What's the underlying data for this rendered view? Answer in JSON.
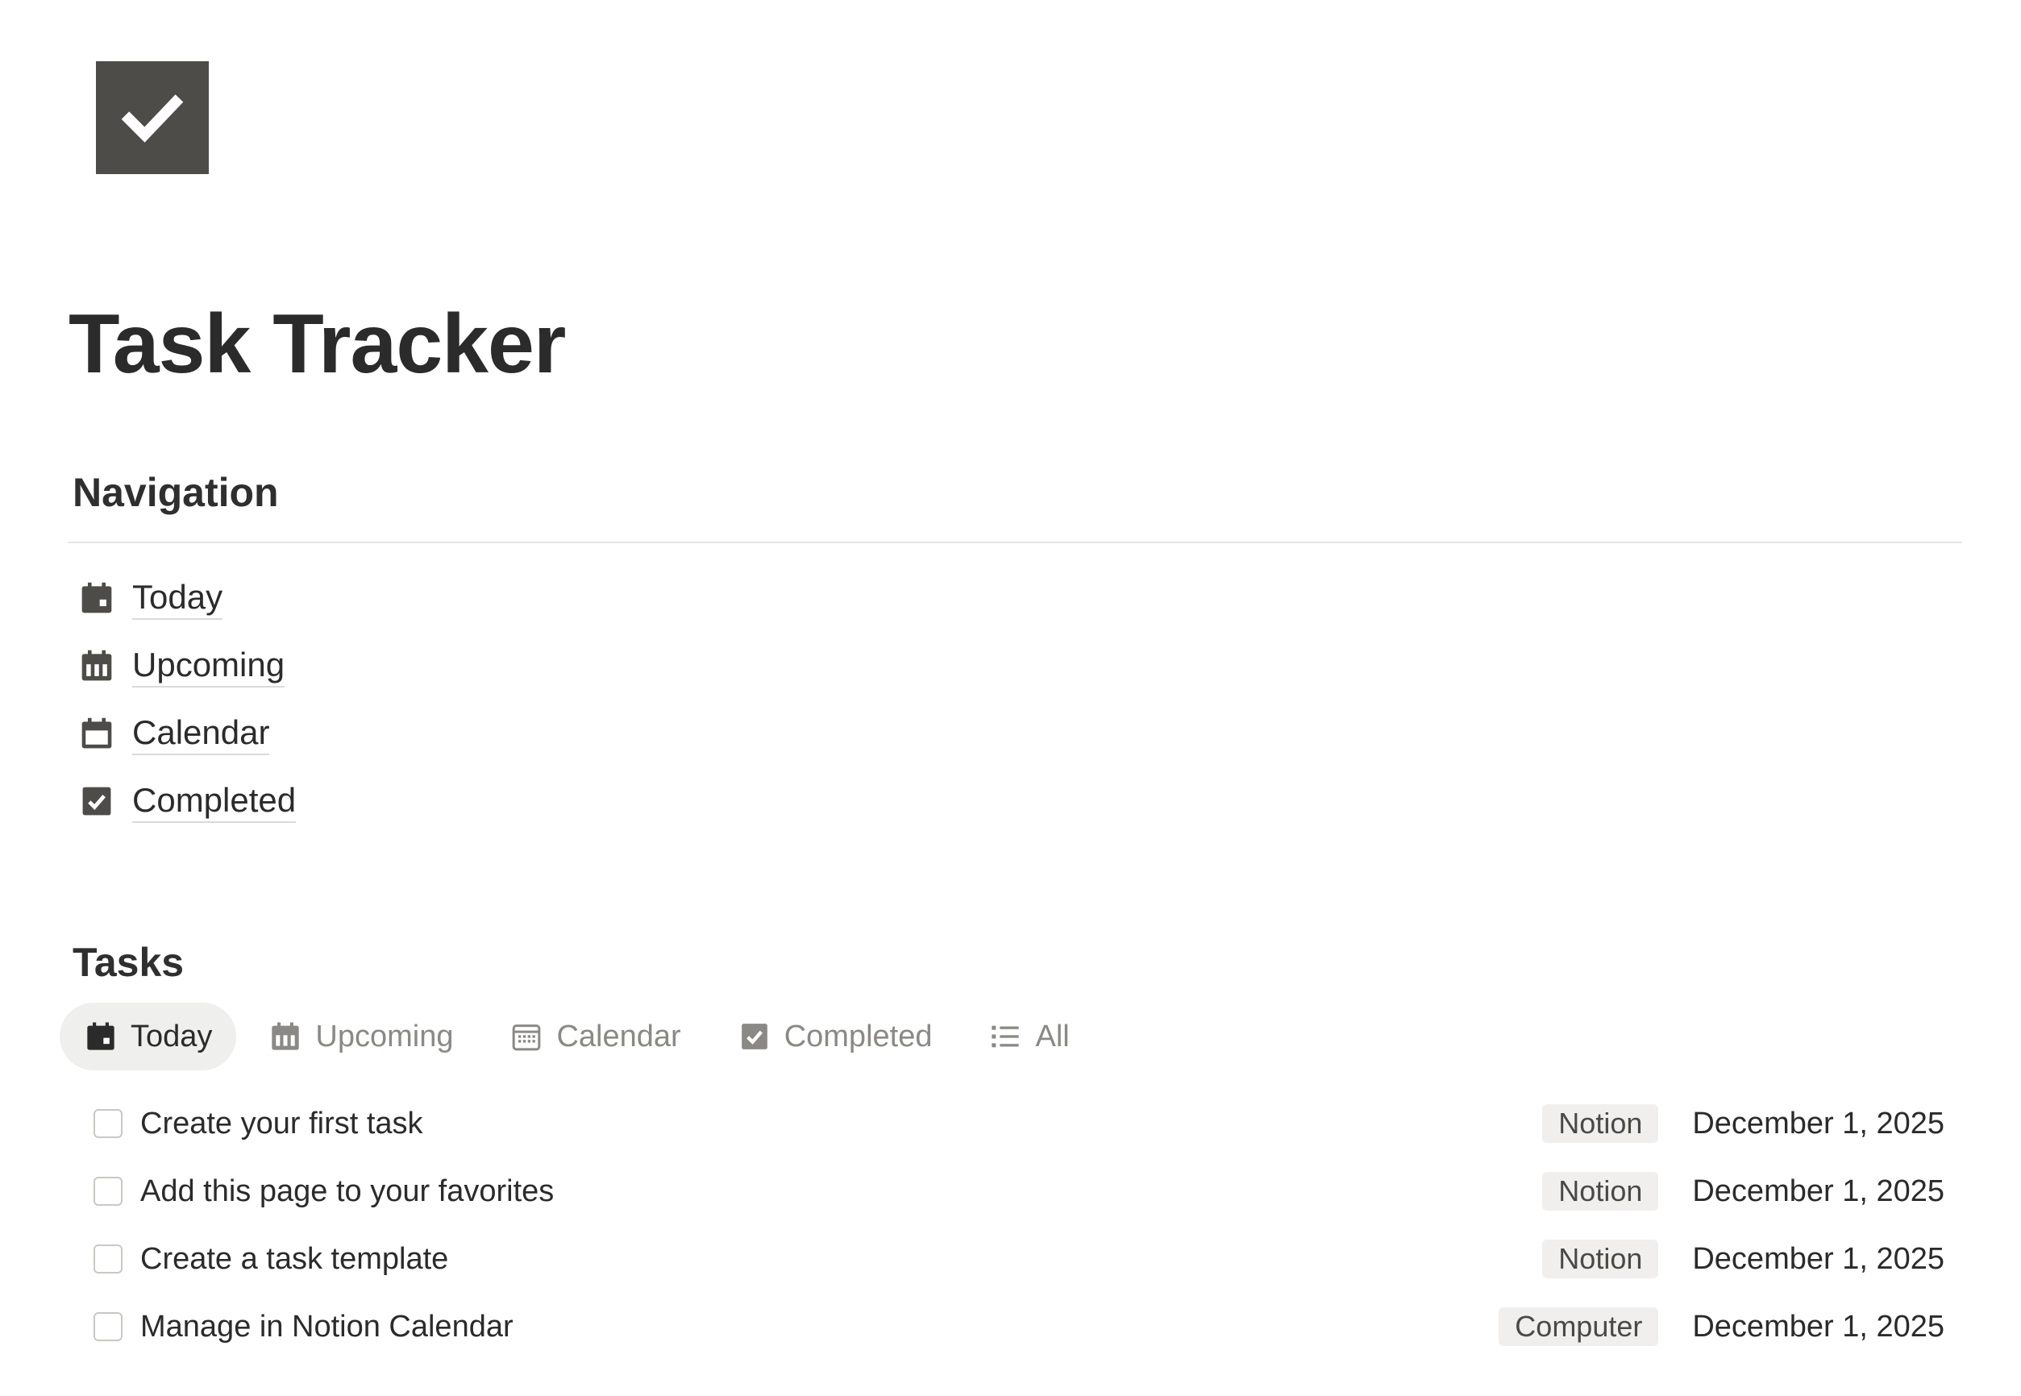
{
  "page": {
    "title": "Task Tracker",
    "icon": "checkmark-square-icon",
    "icon_color": "#4d4c48"
  },
  "navigation": {
    "heading": "Navigation",
    "links": [
      {
        "label": "Today",
        "icon": "calendar-today-icon"
      },
      {
        "label": "Upcoming",
        "icon": "calendar-week-icon"
      },
      {
        "label": "Calendar",
        "icon": "calendar-icon"
      },
      {
        "label": "Completed",
        "icon": "checkbox-checked-icon"
      }
    ]
  },
  "tasks": {
    "heading": "Tasks",
    "tabs": [
      {
        "label": "Today",
        "icon": "calendar-today-icon",
        "active": true
      },
      {
        "label": "Upcoming",
        "icon": "calendar-week-icon",
        "active": false
      },
      {
        "label": "Calendar",
        "icon": "calendar-grid-icon",
        "active": false
      },
      {
        "label": "Completed",
        "icon": "checkbox-checked-icon",
        "active": false
      },
      {
        "label": "All",
        "icon": "list-icon",
        "active": false
      }
    ],
    "items": [
      {
        "title": "Create your first task",
        "tag": "Notion",
        "date": "December 1, 2025",
        "done": false
      },
      {
        "title": "Add this page to your favorites",
        "tag": "Notion",
        "date": "December 1, 2025",
        "done": false
      },
      {
        "title": "Create a task template",
        "tag": "Notion",
        "date": "December 1, 2025",
        "done": false
      },
      {
        "title": "Manage in Notion Calendar",
        "tag": "Computer",
        "date": "December 1, 2025",
        "done": false
      }
    ]
  },
  "colors": {
    "text": "#2b2b2b",
    "muted": "#8a8985",
    "tag_bg": "#f0efed",
    "active_tab_bg": "#efefed"
  }
}
